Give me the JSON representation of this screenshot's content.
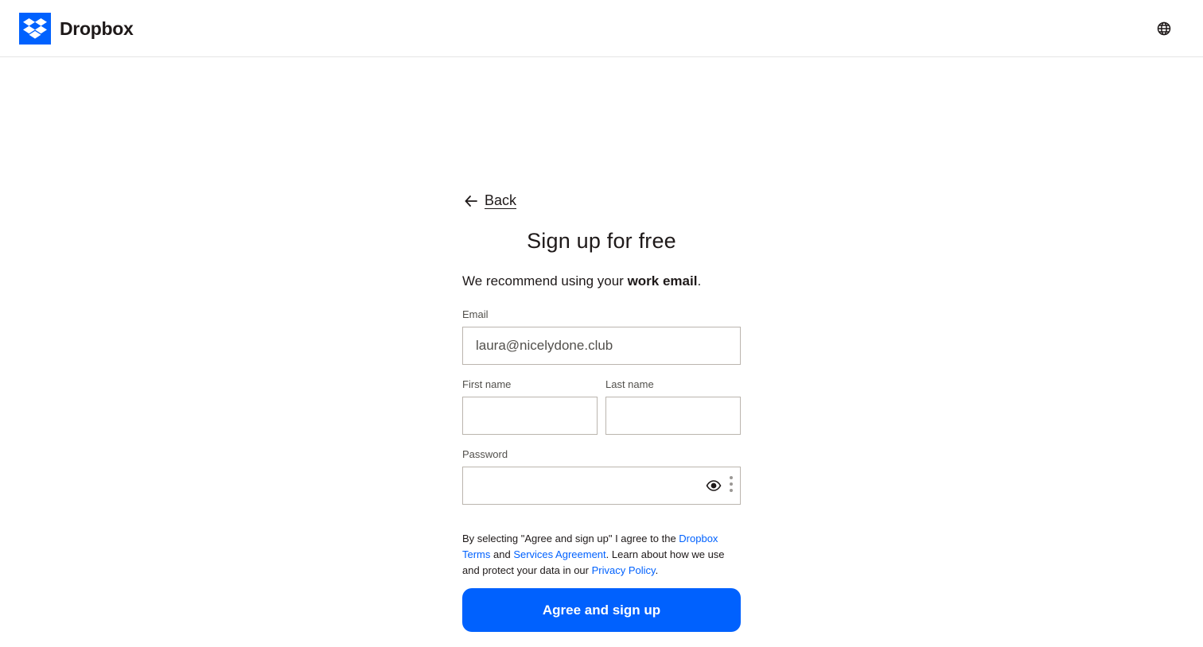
{
  "header": {
    "brand": "Dropbox",
    "logo_icon": "dropbox-logo-icon",
    "language_icon": "globe-icon"
  },
  "form": {
    "back_label": "Back",
    "title": "Sign up for free",
    "recommend_prefix": "We recommend using your ",
    "recommend_bold": "work email",
    "recommend_suffix": ".",
    "email": {
      "label": "Email",
      "value": "laura@nicelydone.club"
    },
    "first_name": {
      "label": "First name",
      "value": ""
    },
    "last_name": {
      "label": "Last name",
      "value": ""
    },
    "password": {
      "label": "Password",
      "value": "",
      "show_icon": "eye-icon",
      "more_icon": "more-vertical-icon"
    },
    "terms": {
      "part1": "By selecting \"Agree and sign up\" I agree to the ",
      "link_terms": "Dropbox Terms",
      "part2": " and ",
      "link_services": "Services Agreement",
      "part3": ". Learn about how we use and protect your data in our ",
      "link_privacy": "Privacy Policy",
      "part4": "."
    },
    "submit_label": "Agree and sign up"
  },
  "colors": {
    "accent": "#0061fe",
    "text": "#1e1919",
    "border": "#bbb5ae"
  }
}
